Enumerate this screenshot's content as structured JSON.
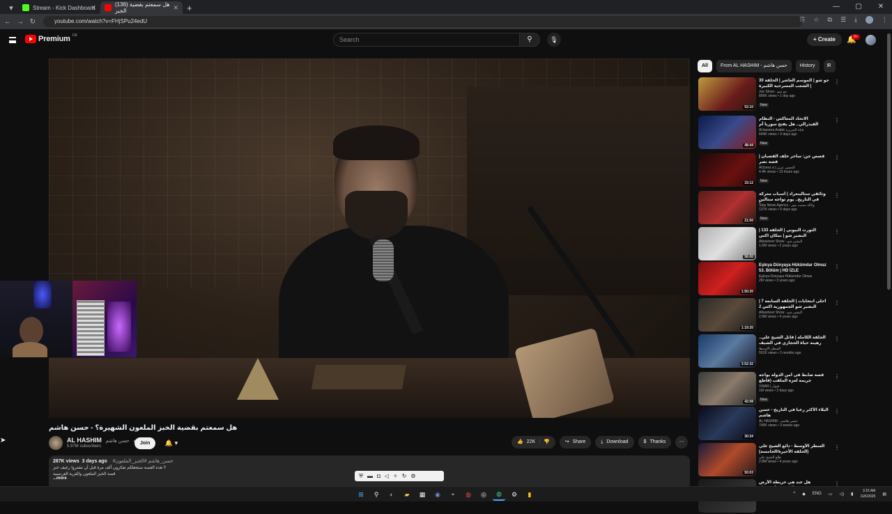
{
  "browser": {
    "tabs": [
      {
        "title": "Stream - Kick Dashboard",
        "fav_color": "#53fc18"
      },
      {
        "title": "(136) هل سمعتم بقضية الخبز",
        "fav_color": "#ff0000"
      }
    ],
    "url": "youtube.com/watch?v=FHjSPu24edU",
    "profile_color": "#8a9bb0"
  },
  "header": {
    "logo_text": "Premium",
    "country": "CA",
    "search_placeholder": "Search",
    "create_label": "Create",
    "notif_badge": "9+"
  },
  "video": {
    "title": "هل سمعتم بقضية الخبز الملعون الشهيرة؟ - حسن هاشم",
    "channel": "AL HASHIM",
    "channel_ar": "حسن هاشم",
    "subscribers": "5.97M subscribers",
    "join": "Join",
    "likes": "22K",
    "share": "Share",
    "download": "Download",
    "thanks": "Thanks"
  },
  "description": {
    "views": "287K views",
    "age": "3 days ago",
    "tags": "#حسن_هاشم #الخبز_الملعون",
    "line1": "هذه القصة ستجعلكم تفكرون ألف مرة قبل أن تشتروا رغيف خبز !!",
    "line2": "قصة الخبز الملعون والقرية الفرنسية",
    "more": "...more"
  },
  "chips": [
    "All",
    "From AL HASHIM - حسن هاشم",
    "History",
    "R"
  ],
  "recommendations": [
    {
      "title": "جو شو | الموسم العاشر | الحلقة 30 | الشعب المسرحية الكبيرة",
      "channel": "Joe Show - جو شو",
      "views": "806K views • 1 day ago",
      "duration": "52:10",
      "new": "New",
      "thumb": "linear-gradient(135deg,#c09a40,#6a1a1a 60%,#2a1a10)"
    },
    {
      "title": "الاتحاد المعاكس - النظام الفيدرالي.. هل يفتح سوريا أم يمزقها؟",
      "channel": "AlJazeera Arabic قناة الجزيرة",
      "views": "644K views • 3 days ago",
      "duration": "48:44",
      "new": "New",
      "thumb": "linear-gradient(135deg,#0a1a4a,#3a4a8a 50%,#8a1a1a)"
    },
    {
      "title": "قصص جن: ساحر خلف القضبان | قصة نصر",
      "channel": "AOzeez a | الحسن عزيز",
      "views": "4.4K views • 13 hours ago",
      "duration": "33:12",
      "new": "New",
      "thumb": "linear-gradient(135deg,#1a0a0a,#6a1010 60%,#2a0a0a)"
    },
    {
      "title": "وثائقي ستالينغراد | أسباب معركة في التاريخ.. يوم تواجه ستالين وهتلر وجهاً",
      "channel": "Step News Agency - وكالة ستيب نيوز",
      "views": "137K views • 5 days ago",
      "duration": "21:50",
      "new": "New",
      "thumb": "linear-gradient(135deg,#5a1a1a,#b03030 55%,#2a1a10)"
    },
    {
      "title": "الثورث البيوبي | الحلقة 133 | البشير شو | نمكان اكس",
      "channel": "Albasheer Show - البشير شو",
      "views": "1.6M views • 2 years ago",
      "duration": "56:00",
      "new": "",
      "thumb": "linear-gradient(135deg,#b0b0b0,#e0e0e0 50%,#808080)"
    },
    {
      "title": "Eşkıya Dünyaya Hükümdar Olmaz 53. Bölüm | HD İZLE",
      "channel": "Eşkıya Dünyaya Hükümdar Olmaz",
      "views": "2M views • 3 years ago",
      "duration": "1:50:20",
      "new": "",
      "thumb": "linear-gradient(135deg,#7a1010,#d02020 50%,#3a0a0a)"
    },
    {
      "title": "أحلى انتخابات | الحلقة السابعة 7 | البشير شو الجمهورية اكس 2",
      "channel": "Albasheer Show - البشير شو",
      "views": "2.9M views • 4 years ago",
      "duration": "1:19:20",
      "new": "",
      "thumb": "linear-gradient(135deg,#2a2a2a,#5a4a3a 50%,#1a1a1a)"
    },
    {
      "title": "الحلقة الكاملة | قاتل الشيخ علي.. رهينة حياة الحجازي في الشيف وخفايا المقاومة العراقية",
      "channel": "السطر الأوسط",
      "views": "561K views • 2 months ago",
      "duration": "3:52:32",
      "new": "",
      "thumb": "linear-gradient(135deg,#1a3a6a,#5a7aa0 50%,#1a1a2a)"
    },
    {
      "title": "قصة ضابط في أمن الدولة يواجه جريمة لغزه الملقب (قاطع التحريات)",
      "channel": "VWAR | فيوار",
      "views": "1M views • 2 days ago",
      "duration": "42:08",
      "new": "New",
      "thumb": "linear-gradient(135deg,#3a3a3a,#8a7a6a 50%,#2a2a2a)"
    },
    {
      "title": "البلاء الأكثر رعباً في التاريخ - حسن هاشم",
      "channel": "AL HASHIM - حسن هاشم",
      "views": "749K views • 3 weeks ago",
      "duration": "30:34",
      "new": "",
      "thumb": "linear-gradient(135deg,#0a0a1a,#2a3a5a 50%,#0a0a1a)"
    },
    {
      "title": "السطر الأوسط - دائع الشيخ علي (الحلقة الأخيرة/الخامسة)",
      "channel": "طلع الشيخ علي",
      "views": "2.8M views • 4 years ago",
      "duration": "50:03",
      "new": "",
      "thumb": "linear-gradient(135deg,#1a1a3a,#b04a2a 50%,#2a1a1a)"
    },
    {
      "title": "هل عند هي خريطة الأرض الحقيقية؟ خريطة",
      "channel": "",
      "views": "",
      "duration": "",
      "new": "",
      "thumb": "linear-gradient(135deg,#1a1a1a,#3a3a3a)"
    }
  ],
  "taskbar": {
    "lang": "ENG",
    "time": "3:15 AM",
    "date": "11/6/2025"
  }
}
